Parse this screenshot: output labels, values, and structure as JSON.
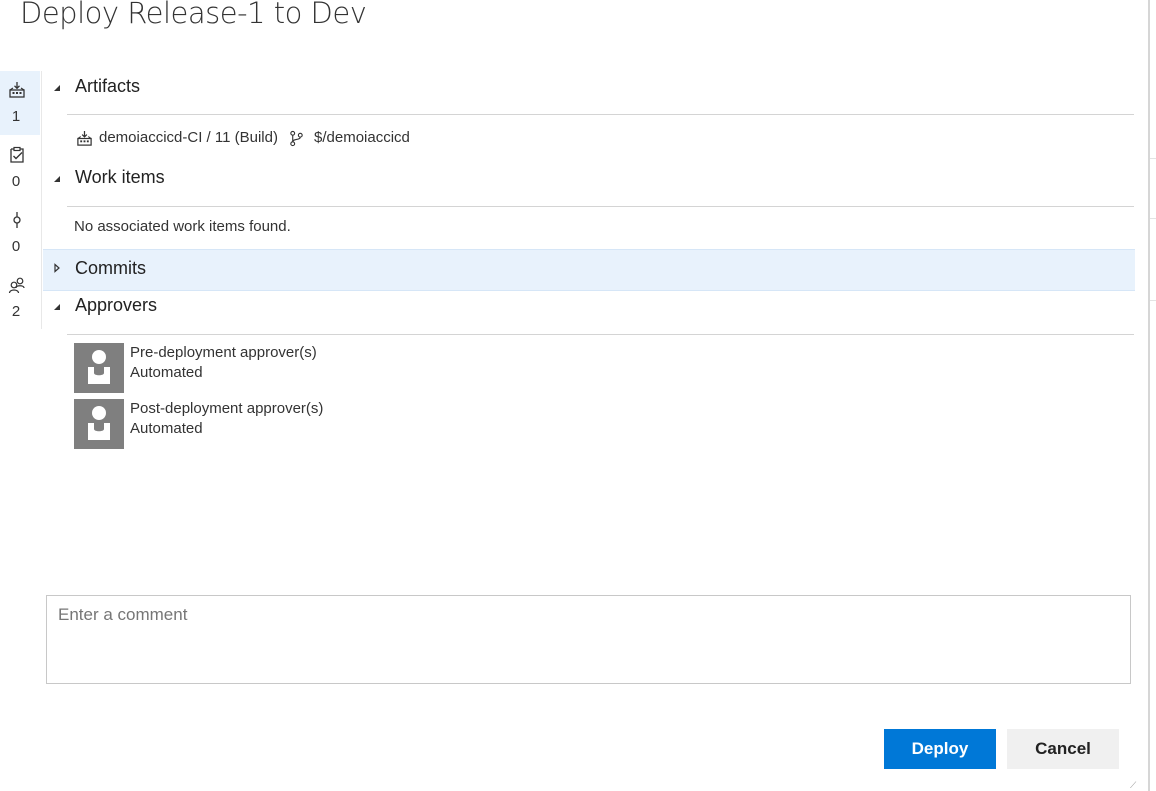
{
  "dialog": {
    "title": "Deploy Release-1 to Dev"
  },
  "rail": {
    "items": [
      {
        "icon": "build-artifact-icon",
        "count": "1",
        "active": true
      },
      {
        "icon": "work-item-icon",
        "count": "0",
        "active": false
      },
      {
        "icon": "commit-icon",
        "count": "0",
        "active": false
      },
      {
        "icon": "approvers-icon",
        "count": "2",
        "active": false
      }
    ]
  },
  "sections": {
    "artifacts": {
      "label": "Artifacts",
      "expanded": true,
      "build": "demoiaccicd-CI / 11 (Build)",
      "repo": "$/demoiaccicd"
    },
    "work_items": {
      "label": "Work items",
      "expanded": true,
      "empty_text": "No associated work items found."
    },
    "commits": {
      "label": "Commits",
      "expanded": false
    },
    "approvers": {
      "label": "Approvers",
      "expanded": true,
      "items": [
        {
          "title": "Pre-deployment approver(s)",
          "subtitle": "Automated"
        },
        {
          "title": "Post-deployment approver(s)",
          "subtitle": "Automated"
        }
      ]
    }
  },
  "comment": {
    "placeholder": "Enter a comment",
    "value": ""
  },
  "buttons": {
    "deploy": "Deploy",
    "cancel": "Cancel"
  },
  "colors": {
    "primary": "#0078d7",
    "highlight": "#e8f2fc",
    "avatar": "#7f7f7f"
  }
}
